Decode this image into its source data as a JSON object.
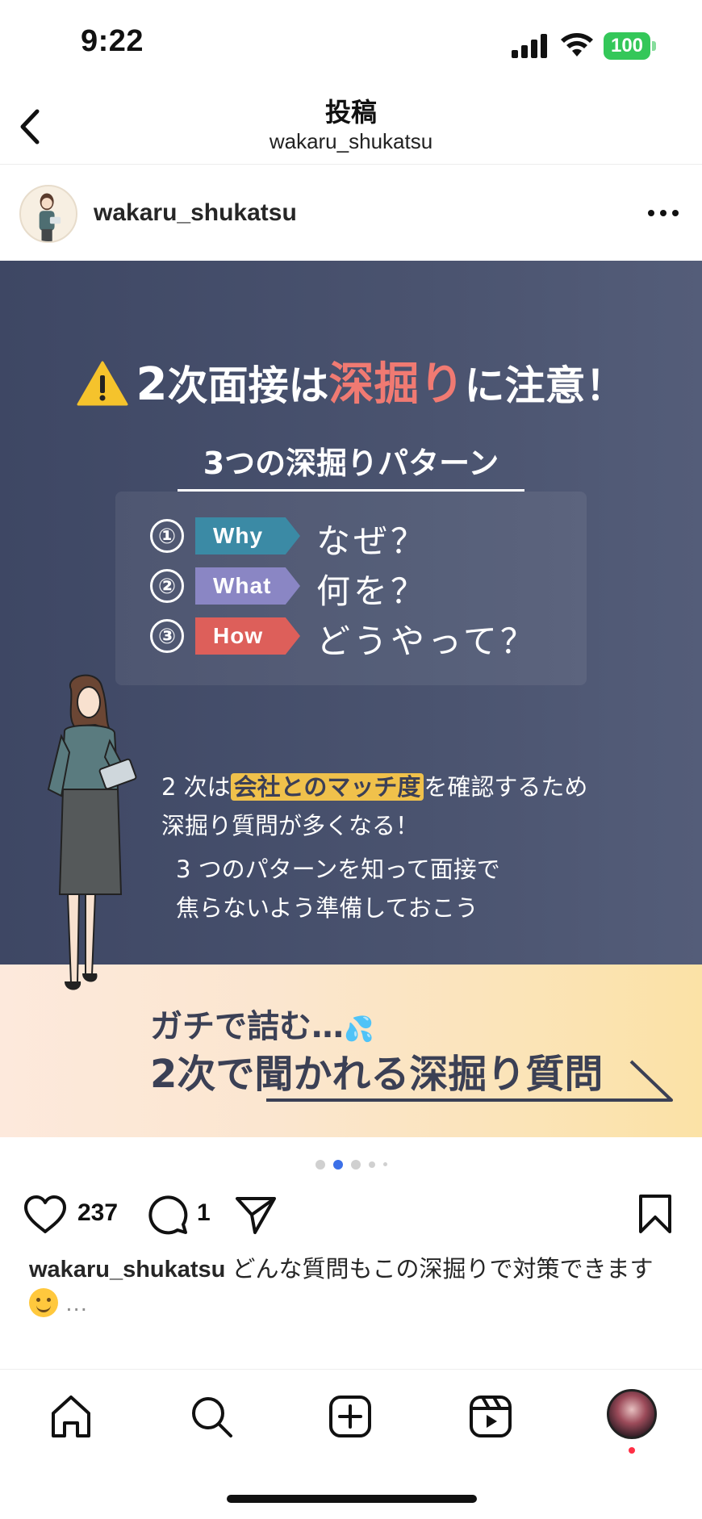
{
  "status_bar": {
    "time": "9:22",
    "battery": "100"
  },
  "header": {
    "title": "投稿",
    "subtitle": "wakaru_shukatsu"
  },
  "post": {
    "username": "wakaru_shukatsu",
    "slide": {
      "headline_num": "2",
      "headline_a": "次面接は",
      "headline_accent": "深掘り",
      "headline_b": "に注意！",
      "pattern_title": "3つの深掘りパターン",
      "patterns": [
        {
          "num": "①",
          "tag": "Why",
          "text": "なぜ？"
        },
        {
          "num": "②",
          "tag": "What",
          "text": "何を？"
        },
        {
          "num": "③",
          "tag": "How",
          "text": "どうやって？"
        }
      ],
      "note1_a": "2 次は",
      "note1_highlight": "会社とのマッチ度",
      "note1_b": "を確認するため",
      "note1_line2": "深掘り質問が多くなる！",
      "note2_line1": "3 つのパターンを知って面接で",
      "note2_line2": "焦らないよう準備しておこう",
      "banner_line1": "ガチで詰む…",
      "banner_drops": "💦",
      "banner_line2": "2次で聞かれる深掘り質問"
    },
    "carousel": {
      "count": 5,
      "active": 2
    },
    "likes": "237",
    "comments": "1",
    "caption_user": "wakaru_shukatsu",
    "caption_text": "どんな質問もこの深掘りで対策できます",
    "caption_more": "…"
  },
  "colors": {
    "slide_bg": "#434c69",
    "accent_red": "#f07a72",
    "why": "#3b8aa5",
    "what": "#8a86c4",
    "how": "#dd5f5a",
    "highlight": "#f0c14b",
    "active_dot": "#3c70e8"
  },
  "tab_bar": [
    "home-icon",
    "search-icon",
    "create-icon",
    "reels-icon",
    "profile-avatar"
  ]
}
